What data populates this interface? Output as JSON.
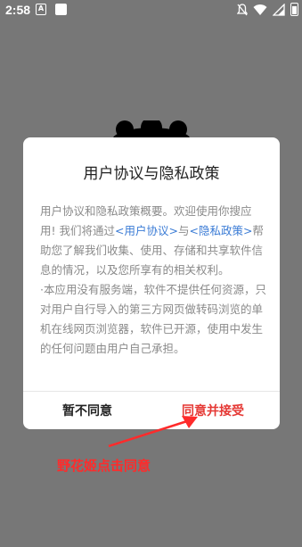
{
  "status_bar": {
    "time": "2:58",
    "app_icon_letter": "A",
    "icons": [
      "notifications-off-icon",
      "wifi-icon",
      "signal-icon",
      "battery-icon"
    ]
  },
  "dialog": {
    "title": "用户协议与隐私政策",
    "paragraph1_before_link1": "用户协议和隐私政策概要。欢迎使用你搜应用! 我们将通过",
    "link1": "<用户协议>",
    "paragraph1_between_links": "与",
    "link2": "<隐私政策>",
    "paragraph1_after_link2": "帮助您了解我们收集、使用、存储和共享软件信息的情况，以及您所享有的相关权利。",
    "paragraph2": "·本应用没有服务端，软件不提供任何资源，只对用户自行导入的第三方网页做转码浏览的单机在线网页浏览器，软件已开源，使用中发生的任何问题由用户自己承担。",
    "disagree_label": "暂不同意",
    "agree_label": "同意并接受"
  },
  "annotation": {
    "text": "野花姬点击同意",
    "color": "#ff2b2b"
  },
  "colors": {
    "overlay": "#777777",
    "link": "#3a7bd5",
    "agree": "#e53935"
  }
}
